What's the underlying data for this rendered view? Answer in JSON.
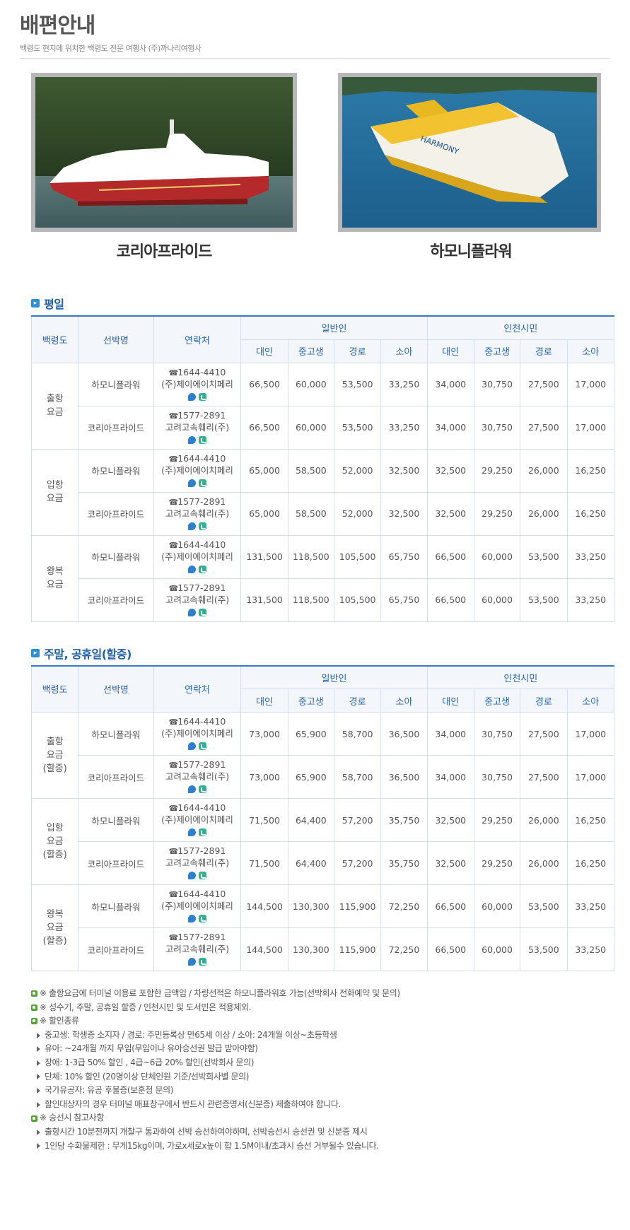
{
  "header": {
    "title": "배편안내",
    "subtitle": "백령도 현지에 위치한 백령도 전문 여행사 (주)까나리여행사"
  },
  "ships": [
    {
      "name": "코리아프라이드"
    },
    {
      "name": "하모니플라워"
    }
  ],
  "table_headers": {
    "region": "백령도",
    "ship": "선박명",
    "contact": "연락처",
    "general": "일반인",
    "incheon": "인천시민",
    "adult": "대인",
    "student": "중고생",
    "senior": "경로",
    "child": "소아"
  },
  "weekday": {
    "title": "평일",
    "groups": [
      {
        "label_lines": [
          "출항",
          "요금"
        ],
        "rows": [
          {
            "ship": "하모니플라워",
            "phone": "1644-4410",
            "company": "(주)제이에이치페리",
            "values": [
              "66,500",
              "60,000",
              "53,500",
              "33,250",
              "34,000",
              "30,750",
              "27,500",
              "17,000"
            ]
          },
          {
            "ship": "코리아프라이드",
            "phone": "1577-2891",
            "company": "고려고속훼리(주)",
            "values": [
              "66,500",
              "60,000",
              "53,500",
              "33,250",
              "34,000",
              "30,750",
              "27,500",
              "17,000"
            ]
          }
        ]
      },
      {
        "label_lines": [
          "입항",
          "요금"
        ],
        "rows": [
          {
            "ship": "하모니플라워",
            "phone": "1644-4410",
            "company": "(주)제이에이치페리",
            "values": [
              "65,000",
              "58,500",
              "52,000",
              "32,500",
              "32,500",
              "29,250",
              "26,000",
              "16,250"
            ]
          },
          {
            "ship": "코리아프라이드",
            "phone": "1577-2891",
            "company": "고려고속훼리(주)",
            "values": [
              "65,000",
              "58,500",
              "52,000",
              "32,500",
              "32,500",
              "29,250",
              "26,000",
              "16,250"
            ]
          }
        ]
      },
      {
        "label_lines": [
          "왕복",
          "요금"
        ],
        "rows": [
          {
            "ship": "하모니플라워",
            "phone": "1644-4410",
            "company": "(주)제이에이치페리",
            "values": [
              "131,500",
              "118,500",
              "105,500",
              "65,750",
              "66,500",
              "60,000",
              "53,500",
              "33,250"
            ]
          },
          {
            "ship": "코리아프라이드",
            "phone": "1577-2891",
            "company": "고려고속훼리(주)",
            "values": [
              "131,500",
              "118,500",
              "105,500",
              "65,750",
              "66,500",
              "60,000",
              "53,500",
              "33,250"
            ]
          }
        ]
      }
    ]
  },
  "weekend": {
    "title": "주말, 공휴일(할증)",
    "groups": [
      {
        "label_lines": [
          "출항",
          "요금",
          "(할증)"
        ],
        "rows": [
          {
            "ship": "하모니플라워",
            "phone": "1644-4410",
            "company": "(주)제이에이치페리",
            "values": [
              "73,000",
              "65,900",
              "58,700",
              "36,500",
              "34,000",
              "30,750",
              "27,500",
              "17,000"
            ]
          },
          {
            "ship": "코리아프라이드",
            "phone": "1577-2891",
            "company": "고려고속훼리(주)",
            "values": [
              "73,000",
              "65,900",
              "58,700",
              "36,500",
              "34,000",
              "30,750",
              "27,500",
              "17,000"
            ]
          }
        ]
      },
      {
        "label_lines": [
          "입항",
          "요금",
          "(할증)"
        ],
        "rows": [
          {
            "ship": "하모니플라워",
            "phone": "1644-4410",
            "company": "(주)제이에이치페리",
            "values": [
              "71,500",
              "64,400",
              "57,200",
              "35,750",
              "32,500",
              "29,250",
              "26,000",
              "16,250"
            ]
          },
          {
            "ship": "코리아프라이드",
            "phone": "1577-2891",
            "company": "고려고속훼리(주)",
            "values": [
              "71,500",
              "64,400",
              "57,200",
              "35,750",
              "32,500",
              "29,250",
              "26,000",
              "16,250"
            ]
          }
        ]
      },
      {
        "label_lines": [
          "왕복",
          "요금",
          "(할증)"
        ],
        "rows": [
          {
            "ship": "하모니플라워",
            "phone": "1644-4410",
            "company": "(주)제이에이치페리",
            "values": [
              "144,500",
              "130,300",
              "115,900",
              "72,250",
              "66,500",
              "60,000",
              "53,500",
              "33,250"
            ]
          },
          {
            "ship": "코리아프라이드",
            "phone": "1577-2891",
            "company": "고려고속훼리(주)",
            "values": [
              "144,500",
              "130,300",
              "115,900",
              "72,250",
              "66,500",
              "60,000",
              "53,500",
              "33,250"
            ]
          }
        ]
      }
    ]
  },
  "notes": [
    {
      "text": "※ 출항요금에 터미널 이용료 포함한 금액임 / 차량선적은 하모니플라워호 가능(선박회사 전화예약 및 문의)",
      "items": []
    },
    {
      "text": "※ 성수기, 주말, 공휴일 할증 / 인천시민 및 도서민은 적용제외.",
      "items": []
    },
    {
      "text": "※ 할인종류",
      "items": [
        "중고생: 학생증 소지자 / 경로: 주민등록상 만65세 이상 / 소아: 24개월 이상~초등학생",
        "유아: ~24개월 까지 무임(무임이나 유아승선권 발급 받아야함)",
        "장애: 1-3급 50% 할인 , 4급~6급 20% 할인(선박회사 문의)",
        "단체: 10% 할인 (20명이상 단체인원 기준/선박회사별 문의)",
        "국가유공자: 유공 후불증(보훈청 문의)",
        "할인대상자의 경우 터미널 매표창구에서 반드시 관련증명서(신분증) 제출하여야 합니다."
      ]
    },
    {
      "text": "※ 승선시 참고사항",
      "items": [
        "출항시간 10분전까지 개찰구 통과하여 선박 승선하여야하며, 선박승선시 승선권 및 신분증 제시",
        "1인당 수화물제한 : 무게15kg이며, 가로x세로x높이 합 1.5M이내/초과시 승선 거부될수 있습니다."
      ]
    }
  ]
}
